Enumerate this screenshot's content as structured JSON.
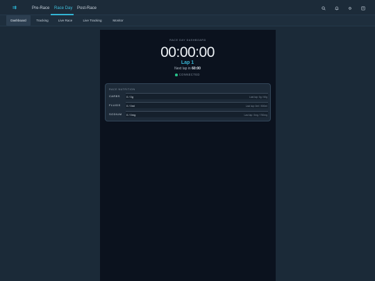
{
  "nav": {
    "logo": "⇉",
    "links": [
      "Pre-Race",
      "Race Day",
      "Post-Race"
    ],
    "active_index": 1
  },
  "icons": [
    "search-icon",
    "bell-icon",
    "gear-icon",
    "user-icon"
  ],
  "subnav": {
    "tabs": [
      "Dashboard",
      "Tracking",
      "Live Race",
      "Live Tracking",
      "Monitor"
    ],
    "active_index": 0
  },
  "dashboard": {
    "title": "RACE DAY DASHBOARD",
    "timer": "00:00:00",
    "lap": "Lap 1",
    "next_lap_prefix": "Next lap in ",
    "next_lap_value": "60:00",
    "status": "CONNECTED"
  },
  "nutrition": {
    "title": "RACE NUTRITION",
    "rows": [
      {
        "label": "CARBS",
        "value": "0 / 0g",
        "goal": "Last lap: 0g / 60g",
        "progress": 0
      },
      {
        "label": "FLUIDS",
        "value": "0 / 0ml",
        "goal": "Last lap: 0ml / 500ml",
        "progress": 0
      },
      {
        "label": "SODIUM",
        "value": "0 / 0mg",
        "goal": "Last lap: 0mg / 750mg",
        "progress": 0
      }
    ]
  },
  "colors": {
    "accent": "#33b4d4",
    "status": "#28c08a",
    "background": "#1b2a38",
    "panel": "#0b121e"
  }
}
